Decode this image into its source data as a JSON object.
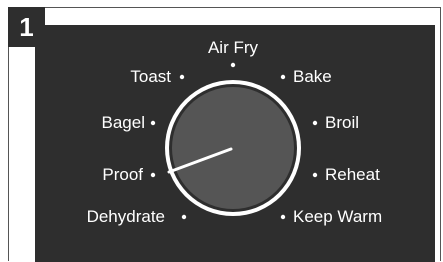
{
  "step": {
    "number": "1"
  },
  "dial": {
    "options": [
      {
        "id": "air-fry",
        "label": "Air Fry"
      },
      {
        "id": "toast",
        "label": "Toast"
      },
      {
        "id": "bake",
        "label": "Bake"
      },
      {
        "id": "bagel",
        "label": "Bagel"
      },
      {
        "id": "broil",
        "label": "Broil"
      },
      {
        "id": "proof",
        "label": "Proof"
      },
      {
        "id": "reheat",
        "label": "Reheat"
      },
      {
        "id": "dehydrate",
        "label": "Dehydrate"
      },
      {
        "id": "keep-warm",
        "label": "Keep Warm"
      }
    ],
    "selected": "Proof",
    "colors": {
      "panel": "#2e2e2e",
      "knob_ring": "#ffffff",
      "knob_face": "#555555",
      "indicator": "#ffffff",
      "badge": "#2e2e2e"
    }
  }
}
